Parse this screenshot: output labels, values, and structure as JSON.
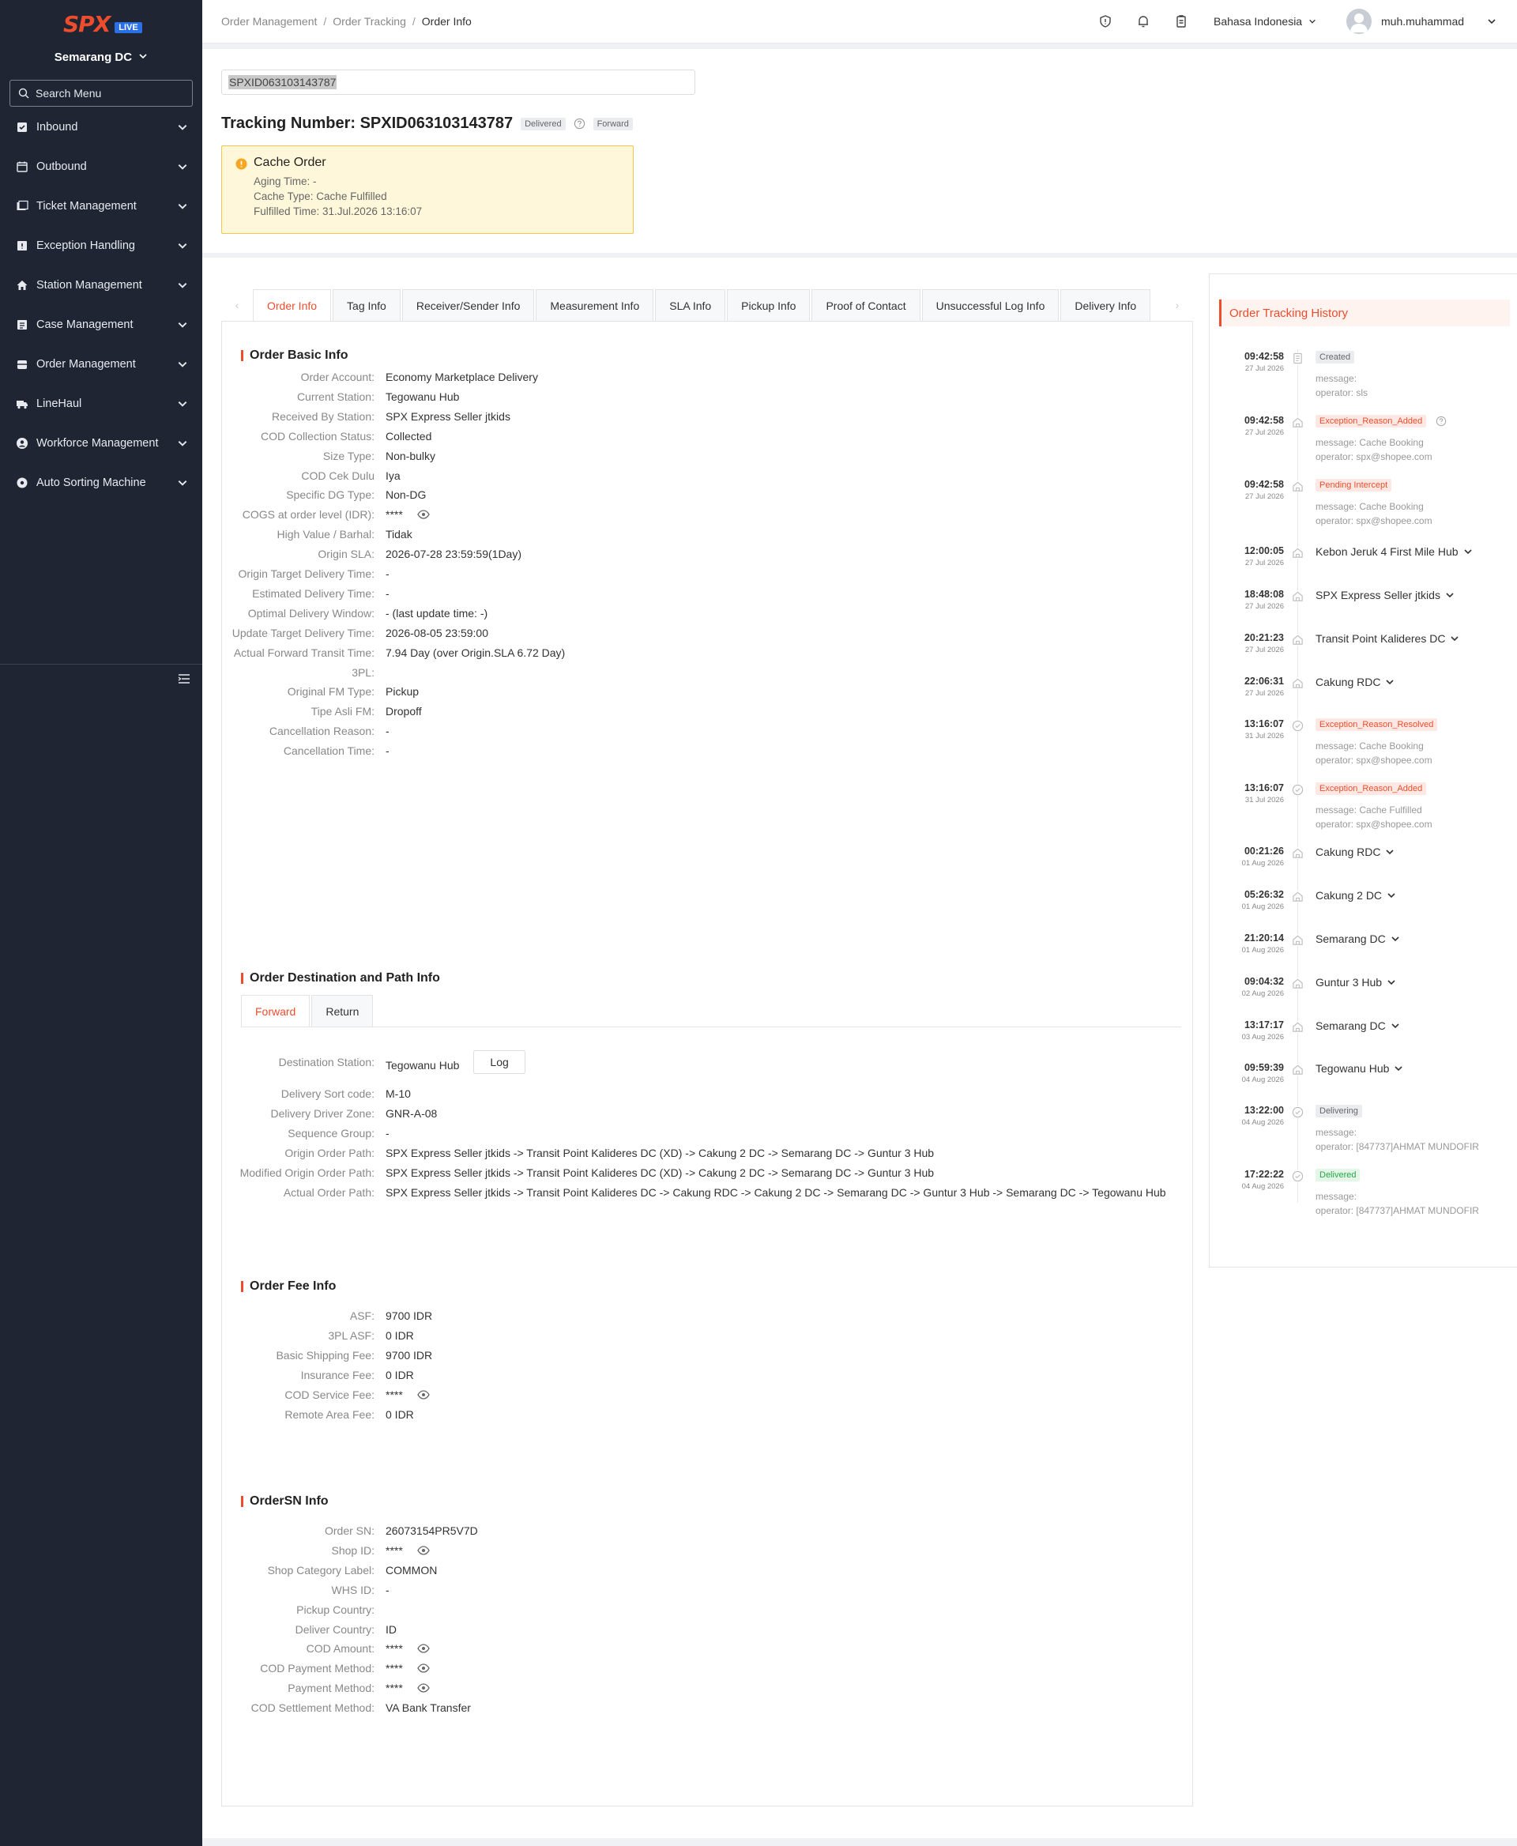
{
  "sidebar": {
    "logo": "SPX",
    "live": "LIVE",
    "station": "Semarang DC",
    "search_placeholder": "Search Menu",
    "items": [
      {
        "label": "Inbound",
        "icon": "inbound-icon"
      },
      {
        "label": "Outbound",
        "icon": "outbound-icon"
      },
      {
        "label": "Ticket Management",
        "icon": "ticket-icon"
      },
      {
        "label": "Exception Handling",
        "icon": "exception-icon"
      },
      {
        "label": "Station Management",
        "icon": "home-icon"
      },
      {
        "label": "Case Management",
        "icon": "case-icon"
      },
      {
        "label": "Order Management",
        "icon": "order-icon"
      },
      {
        "label": "LineHaul",
        "icon": "truck-icon"
      },
      {
        "label": "Workforce Management",
        "icon": "user-icon"
      },
      {
        "label": "Auto Sorting Machine",
        "icon": "gear-icon"
      }
    ]
  },
  "header": {
    "breadcrumb": [
      "Order Management",
      "Order Tracking",
      "Order Info"
    ],
    "language": "Bahasa Indonesia",
    "user": "muh.muhammad"
  },
  "top": {
    "input_value": "SPXID063103143787",
    "title": "Tracking Number: SPXID063103143787",
    "status_tag": "Delivered",
    "direction_tag": "Forward",
    "cache": {
      "title": "Cache Order",
      "aging": "Aging Time: -",
      "type": "Cache Type: Cache Fulfilled",
      "fulfilled": "Fulfilled Time: 31.Jul.2026 13:16:07"
    }
  },
  "tabs": [
    "Order Info",
    "Tag Info",
    "Receiver/Sender Info",
    "Measurement Info",
    "SLA Info",
    "Pickup Info",
    "Proof of Contact",
    "Unsuccessful Log Info",
    "Delivery Info"
  ],
  "basic": {
    "title": "Order Basic Info",
    "rows": [
      {
        "label": "Order Account:",
        "value": "Economy Marketplace Delivery"
      },
      {
        "label": "Current Station:",
        "value": "Tegowanu Hub"
      },
      {
        "label": "Received By Station:",
        "value": "SPX Express Seller jtkids"
      },
      {
        "label": "COD Collection Status:",
        "value": "Collected"
      },
      {
        "label": "Size Type:",
        "value": "Non-bulky"
      },
      {
        "label": "COD Cek Dulu",
        "value": "Iya"
      },
      {
        "label": "Specific DG Type:",
        "value": "Non-DG"
      },
      {
        "label": "COGS at order level (IDR):",
        "value": "****"
      },
      {
        "label": "High Value / Barhal:",
        "value": "Tidak"
      },
      {
        "label": "Origin SLA:",
        "value": "2026-07-28 23:59:59(1Day)"
      },
      {
        "label": "Origin Target Delivery Time:",
        "value": "-"
      },
      {
        "label": "Estimated Delivery Time:",
        "value": "-"
      },
      {
        "label": "Optimal Delivery Window:",
        "value": "- (last update time: -)"
      },
      {
        "label": "Update Target Delivery Time:",
        "value": "2026-08-05 23:59:00"
      },
      {
        "label": "Actual Forward Transit Time:",
        "value": "7.94 Day (over Origin.SLA 6.72 Day)"
      },
      {
        "label": "3PL:",
        "value": ""
      },
      {
        "label": "Original FM Type:",
        "value": "Pickup"
      },
      {
        "label": "Tipe Asli FM:",
        "value": "Dropoff"
      },
      {
        "label": "Cancellation Reason:",
        "value": "-"
      },
      {
        "label": "Cancellation Time:",
        "value": "-"
      }
    ]
  },
  "dest": {
    "title": "Order Destination and Path Info",
    "subtabs": [
      "Forward",
      "Return"
    ],
    "log_button": "Log",
    "rows": [
      {
        "label": "Destination Station:",
        "value": "Tegowanu Hub"
      },
      {
        "label": "Delivery Sort code:",
        "value": "M-10"
      },
      {
        "label": "Delivery Driver Zone:",
        "value": "GNR-A-08"
      },
      {
        "label": "Sequence Group:",
        "value": "-"
      },
      {
        "label": "Origin Order Path:",
        "value": "SPX Express Seller jtkids  -> Transit Point Kalideres DC (XD)  -> Cakung 2 DC  -> Semarang DC  -> Guntur 3 Hub"
      },
      {
        "label": "Modified Origin Order Path:",
        "value": "SPX Express Seller jtkids  -> Transit Point Kalideres DC (XD)  -> Cakung 2 DC  -> Semarang DC  -> Guntur 3 Hub"
      },
      {
        "label": "Actual Order Path:",
        "value": "SPX Express Seller jtkids  -> Transit Point Kalideres DC  -> Cakung RDC  -> Cakung 2 DC  -> Semarang DC  -> Guntur 3 Hub  -> Semarang DC  -> Tegowanu Hub"
      }
    ]
  },
  "fee": {
    "title": "Order Fee Info",
    "rows": [
      {
        "label": "ASF:",
        "value": "9700 IDR"
      },
      {
        "label": "3PL ASF:",
        "value": "0 IDR"
      },
      {
        "label": "Basic Shipping Fee:",
        "value": "9700 IDR"
      },
      {
        "label": "Insurance Fee:",
        "value": "0 IDR"
      },
      {
        "label": "COD Service Fee:",
        "value": "****"
      },
      {
        "label": "Remote Area Fee:",
        "value": "0 IDR"
      }
    ]
  },
  "ordersn": {
    "title": "OrderSN Info",
    "rows": [
      {
        "label": "Order SN:",
        "value": "26073154PR5V7D"
      },
      {
        "label": "Shop ID:",
        "value": "****"
      },
      {
        "label": "Shop Category Label:",
        "value": "COMMON"
      },
      {
        "label": "WHS ID:",
        "value": "-"
      },
      {
        "label": "Pickup Country:",
        "value": ""
      },
      {
        "label": "Deliver Country:",
        "value": "ID"
      },
      {
        "label": "COD Amount:",
        "value": "****"
      },
      {
        "label": "COD Payment Method:",
        "value": "****"
      },
      {
        "label": "Payment Method:",
        "value": "****"
      },
      {
        "label": "COD Settlement Method:",
        "value": "VA Bank Transfer"
      }
    ]
  },
  "history": {
    "title": "Order Tracking History",
    "events": [
      {
        "time": "09:42:58",
        "date": "27 Jul 2026",
        "kind": "badge",
        "badge": "Created",
        "badge_style": "grey",
        "message": "message:",
        "operator": "operator: sls",
        "icon": "doc-icon"
      },
      {
        "time": "09:42:58",
        "date": "27 Jul 2026",
        "kind": "badge",
        "badge": "Exception_Reason_Added",
        "badge_style": "red",
        "help": true,
        "message": "message: Cache Booking",
        "operator": "operator: spx@shopee.com",
        "icon": "house-icon"
      },
      {
        "time": "09:42:58",
        "date": "27 Jul 2026",
        "kind": "badge",
        "badge": "Pending Intercept",
        "badge_style": "red",
        "message": "message: Cache Booking",
        "operator": "operator: spx@shopee.com",
        "icon": "house-icon"
      },
      {
        "time": "12:00:05",
        "date": "27 Jul 2026",
        "kind": "station",
        "station": "Kebon Jeruk 4 First Mile Hub",
        "icon": "house-icon"
      },
      {
        "time": "18:48:08",
        "date": "27 Jul 2026",
        "kind": "station",
        "station": "SPX Express Seller jtkids",
        "icon": "house-icon"
      },
      {
        "time": "20:21:23",
        "date": "27 Jul 2026",
        "kind": "station",
        "station": "Transit Point Kalideres DC",
        "icon": "house-icon"
      },
      {
        "time": "22:06:31",
        "date": "27 Jul 2026",
        "kind": "station",
        "station": "Cakung RDC",
        "icon": "house-icon"
      },
      {
        "time": "13:16:07",
        "date": "31 Jul 2026",
        "kind": "badge",
        "badge": "Exception_Reason_Resolved",
        "badge_style": "red",
        "message": "message: Cache Booking",
        "operator": "operator: spx@shopee.com",
        "icon": "check-circle-icon"
      },
      {
        "time": "13:16:07",
        "date": "31 Jul 2026",
        "kind": "badge",
        "badge": "Exception_Reason_Added",
        "badge_style": "red",
        "message": "message: Cache Fulfilled",
        "operator": "operator: spx@shopee.com",
        "icon": "check-circle-icon"
      },
      {
        "time": "00:21:26",
        "date": "01 Aug 2026",
        "kind": "station",
        "station": "Cakung RDC",
        "icon": "house-icon"
      },
      {
        "time": "05:26:32",
        "date": "01 Aug 2026",
        "kind": "station",
        "station": "Cakung 2 DC",
        "icon": "house-icon"
      },
      {
        "time": "21:20:14",
        "date": "01 Aug 2026",
        "kind": "station",
        "station": "Semarang DC",
        "icon": "house-icon"
      },
      {
        "time": "09:04:32",
        "date": "02 Aug 2026",
        "kind": "station",
        "station": "Guntur 3 Hub",
        "icon": "house-icon"
      },
      {
        "time": "13:17:17",
        "date": "03 Aug 2026",
        "kind": "station",
        "station": "Semarang DC",
        "icon": "house-icon"
      },
      {
        "time": "09:59:39",
        "date": "04 Aug 2026",
        "kind": "station",
        "station": "Tegowanu Hub",
        "icon": "house-icon"
      },
      {
        "time": "13:22:00",
        "date": "04 Aug 2026",
        "kind": "badge",
        "badge": "Delivering",
        "badge_style": "grey",
        "message": "message:",
        "operator": "operator: [847737]AHMAT MUNDOFIR",
        "icon": "check-circle-icon"
      },
      {
        "time": "17:22:22",
        "date": "04 Aug 2026",
        "kind": "badge",
        "badge": "Delivered",
        "badge_style": "green",
        "message": "message:",
        "operator": "operator: [847737]AHMAT MUNDOFIR",
        "icon": "check-circle-icon"
      }
    ]
  },
  "colors": {
    "brand": "#ee4d2d",
    "sidebar": "#1f2533",
    "live": "#2b6fe6"
  }
}
